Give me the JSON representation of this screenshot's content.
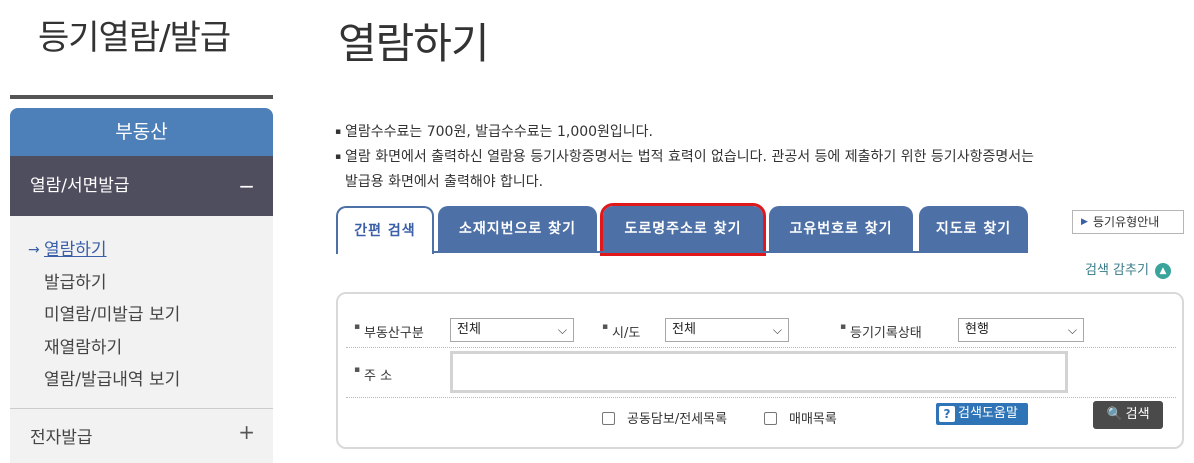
{
  "sidebar": {
    "title": "등기열람/발급",
    "category": "부동산",
    "submenu": {
      "label": "열람/서면발급",
      "toggle": "−"
    },
    "items": [
      {
        "label": "열람하기",
        "active": true
      },
      {
        "label": "발급하기"
      },
      {
        "label": "미열람/미발급 보기"
      },
      {
        "label": "재열람하기"
      },
      {
        "label": "열람/발급내역 보기"
      }
    ],
    "footer": {
      "label": "전자발급",
      "toggle": "+"
    }
  },
  "main": {
    "title": "열람하기",
    "notices": [
      "열람수수료는 700원, 발급수수료는 1,000원입니다.",
      "열람 화면에서 출력하신 열람용 등기사항증명서는 법적 효력이 없습니다. 관공서 등에 제출하기 위한 등기사항증명서는",
      "발급용 화면에서 출력해야 합니다."
    ],
    "tabs": [
      {
        "label": "간편 검색"
      },
      {
        "label": "소재지번으로 찾기"
      },
      {
        "label": "도로명주소로 찾기"
      },
      {
        "label": "고유번호로 찾기"
      },
      {
        "label": "지도로 찾기"
      }
    ],
    "guide_button": "등기유형안내",
    "hide_search": "검색 감추기",
    "form": {
      "property_type": {
        "label": "부동산구분",
        "value": "전체"
      },
      "sido": {
        "label": "시/도",
        "value": "전체"
      },
      "record_status": {
        "label": "등기기록상태",
        "value": "현행"
      },
      "address": {
        "label": "주 소",
        "value": ""
      },
      "checkbox_joint": "공동담보/전세목록",
      "checkbox_trade": "매매목록",
      "help_button": "검색도움말",
      "search_button": "검색"
    }
  },
  "colors": {
    "tab_blue": "#4d70a6",
    "sidebar_blue": "#4d7fb8",
    "sidebar_dark": "#4f4e5e",
    "highlight_red": "#e0181c"
  }
}
